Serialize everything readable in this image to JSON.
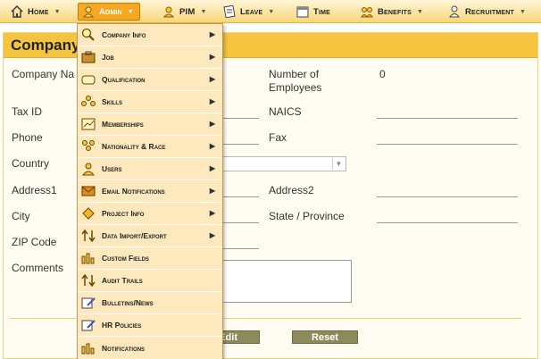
{
  "nav": [
    {
      "label": "Home",
      "icon": "home-icon",
      "caret": "▼"
    },
    {
      "label": "Admin",
      "icon": "admin-icon",
      "caret": "▼"
    },
    {
      "label": "PIM",
      "icon": "pim-icon",
      "caret": "▼"
    },
    {
      "label": "Leave",
      "icon": "leave-icon",
      "caret": "▼"
    },
    {
      "label": "Time",
      "icon": "time-icon"
    },
    {
      "label": "Benefits",
      "icon": "benefits-icon",
      "caret": "▼"
    },
    {
      "label": "Recruitment",
      "icon": "recruitment-icon",
      "caret": "▼"
    }
  ],
  "card": {
    "title": "Company",
    "labels": {
      "company_name": "Company Na",
      "tax_id": "Tax ID",
      "phone": "Phone",
      "country": "Country",
      "address1": "Address1",
      "city": "City",
      "zip": "ZIP Code",
      "comments": "Comments",
      "employees": "Number of Employees",
      "naics": "NAICS",
      "fax": "Fax",
      "address2": "Address2",
      "state": "State / Province"
    },
    "employees_value": "0",
    "buttons": {
      "edit": "Edit",
      "reset": "Reset"
    }
  },
  "menu": {
    "items": [
      {
        "label": "Company Info",
        "icon": "magnifier-icon",
        "submenu": true
      },
      {
        "label": "Job",
        "icon": "briefcase-icon",
        "submenu": true
      },
      {
        "label": "Qualification",
        "icon": "diploma-icon",
        "submenu": true
      },
      {
        "label": "Skills",
        "icon": "people-icon",
        "submenu": true
      },
      {
        "label": "Memberships",
        "icon": "chart-icon",
        "submenu": true
      },
      {
        "label": "Nationality & Race",
        "icon": "group-icon",
        "submenu": true
      },
      {
        "label": "Users",
        "icon": "user-icon",
        "submenu": true
      },
      {
        "label": "Email Notifications",
        "icon": "envelope-icon",
        "submenu": true
      },
      {
        "label": "Project Info",
        "icon": "project-icon",
        "submenu": true
      },
      {
        "label": "Data Import/Export",
        "icon": "import-export-icon",
        "submenu": true
      },
      {
        "label": "Custom Fields",
        "icon": "bar-chart-icon",
        "submenu": false
      },
      {
        "label": "Audit Trails",
        "icon": "arrows-icon",
        "submenu": false
      },
      {
        "label": "Bulletins/News",
        "icon": "pen-paper-icon",
        "submenu": false
      },
      {
        "label": "HR Policies",
        "icon": "policy-icon",
        "submenu": false
      },
      {
        "label": "Notifications",
        "icon": "bell-chart-icon",
        "submenu": false
      }
    ],
    "submenu_arrow": "▶"
  },
  "colors": {
    "accent": "#f5c43f",
    "active_tab": "#f6a822",
    "menu_bg": "#fde9bd",
    "button": "#8d8a5a"
  }
}
